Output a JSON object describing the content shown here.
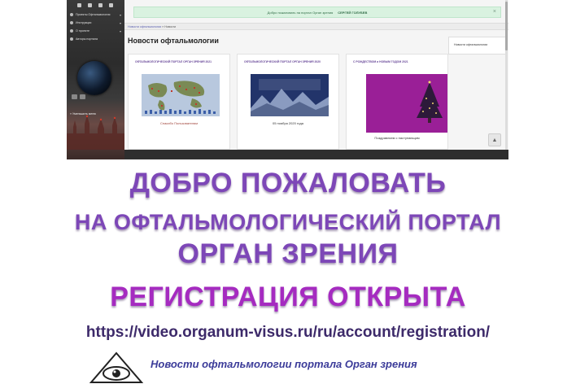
{
  "screenshot": {
    "sidebar": {
      "menu": [
        {
          "label": "Проекты Офтальмология",
          "icon": "folder-icon",
          "has_submenu": true
        },
        {
          "label": "Инструкции",
          "icon": "info-icon",
          "has_submenu": true
        },
        {
          "label": "О проекте",
          "icon": "about-icon",
          "has_submenu": true
        },
        {
          "label": "Авторы портала",
          "icon": "users-icon",
          "has_submenu": false
        }
      ],
      "collapse_label": "Уменьшить меню"
    },
    "alert": {
      "text": "Добро пожаловать на портал Орган зрения",
      "user": "СЕРГЕЙ ГОЛУБЕВ",
      "color": "#d9f2e0"
    },
    "breadcrumb": {
      "link": "Новости офтальмологии",
      "sep": " » ",
      "current": "Новости"
    },
    "page_title": "Новости офтальмологии",
    "right_sidebar_item": "Новости офтальмологии",
    "cards": [
      {
        "title": "ОФТАЛЬМОЛОГИЧЕСКИЙ ПОРТАЛ ОРГАН ЗРЕНИЯ 2021",
        "caption": "Спасибо Пользователям"
      },
      {
        "title": "ОФТАЛЬМОЛОГИЧЕСКИЙ ПОРТАЛ ОРГАН ЗРЕНИЯ 2020",
        "caption": "05 ноября 2020 года"
      },
      {
        "title": "С РОЖДЕСТВОМ и НОВЫМ ГОДОМ 2021",
        "caption": "Поздравляем с наступающим"
      }
    ]
  },
  "banner": {
    "line1": "ДОБРО ПОЖАЛОВАТЬ",
    "line2": "НА ОФТАЛЬМОЛОГИЧЕСКИЙ ПОРТАЛ",
    "line3": "ОРГАН ЗРЕНИЯ",
    "line4": "РЕГИСТРАЦИЯ ОТКРЫТА",
    "url": "https://video.organum-visus.ru/ru/account/registration/",
    "accent": "#7d47b7"
  },
  "footer": {
    "line1": "Новости офтальмологии портала Орган зрения"
  }
}
